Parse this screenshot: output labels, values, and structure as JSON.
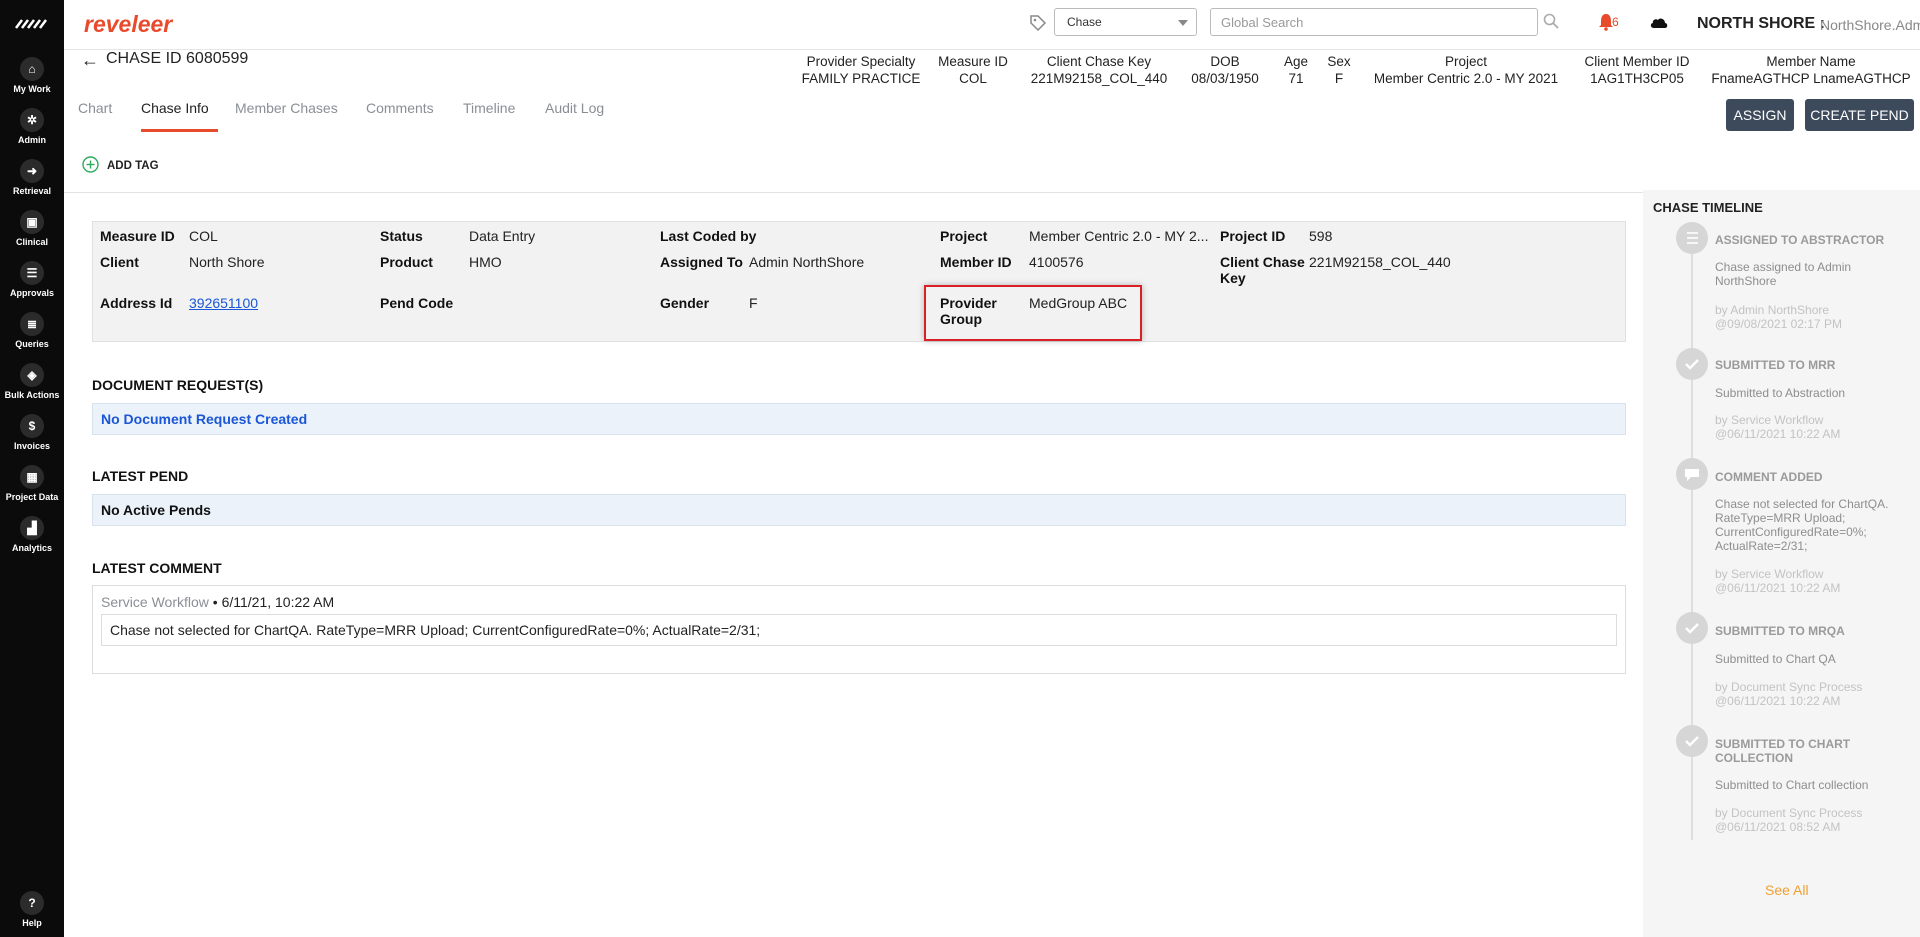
{
  "sidebar": {
    "items": [
      {
        "label": "My Work",
        "icon": "home-icon"
      },
      {
        "label": "Admin",
        "icon": "gear-icon"
      },
      {
        "label": "Retrieval",
        "icon": "arrow-in-icon"
      },
      {
        "label": "Clinical",
        "icon": "clipboard-icon"
      },
      {
        "label": "Approvals",
        "icon": "list-check-icon"
      },
      {
        "label": "Queries",
        "icon": "queries-icon"
      },
      {
        "label": "Bulk Actions",
        "icon": "layers-icon"
      },
      {
        "label": "Invoices",
        "icon": "dollar-icon"
      },
      {
        "label": "Project Data",
        "icon": "grid-icon"
      },
      {
        "label": "Analytics",
        "icon": "chart-icon"
      }
    ],
    "help_label": "Help"
  },
  "topbar": {
    "brand": "reveleer",
    "type_select": "Chase",
    "search_placeholder": "Global Search",
    "notification_count": "6",
    "org_name": "NORTH SHORE :",
    "user_name": "NorthShore.Admin"
  },
  "chase": {
    "title": "CHASE ID 6080599",
    "header_fields": [
      {
        "label": "Provider Specialty",
        "value": "FAMILY PRACTICE"
      },
      {
        "label": "Measure ID",
        "value": "COL"
      },
      {
        "label": "Client Chase Key",
        "value": "221M92158_COL_440"
      },
      {
        "label": "DOB",
        "value": "08/03/1950"
      },
      {
        "label": "Age",
        "value": "71"
      },
      {
        "label": "Sex",
        "value": "F"
      },
      {
        "label": "Project",
        "value": "Member Centric 2.0 - MY 2021"
      },
      {
        "label": "Client Member ID",
        "value": "1AG1TH3CP05"
      },
      {
        "label": "Member Name",
        "value": "FnameAGTHCP LnameAGTHCP"
      }
    ]
  },
  "tabs": [
    "Chart",
    "Chase Info",
    "Member Chases",
    "Comments",
    "Timeline",
    "Audit Log"
  ],
  "actions": {
    "assign": "ASSIGN",
    "create_pend": "CREATE PEND"
  },
  "add_tag": "ADD TAG",
  "info": {
    "measure_id": {
      "label": "Measure ID",
      "value": "COL"
    },
    "client": {
      "label": "Client",
      "value": "North Shore"
    },
    "address_id": {
      "label": "Address Id",
      "value": "392651100"
    },
    "status": {
      "label": "Status",
      "value": "Data Entry"
    },
    "product": {
      "label": "Product",
      "value": "HMO"
    },
    "pend_code": {
      "label": "Pend Code",
      "value": ""
    },
    "last_coded_by": {
      "label": "Last Coded by",
      "value": ""
    },
    "assigned_to": {
      "label": "Assigned To",
      "value": "Admin NorthShore"
    },
    "gender": {
      "label": "Gender",
      "value": "F"
    },
    "project": {
      "label": "Project",
      "value": "Member Centric 2.0 - MY 2..."
    },
    "member_id": {
      "label": "Member ID",
      "value": "4100576"
    },
    "provider_group": {
      "label_line1": "Provider",
      "label_line2": "Group",
      "value": "MedGroup ABC"
    },
    "project_id": {
      "label": "Project ID",
      "value": "598"
    },
    "client_chase_key": {
      "label_line1": "Client Chase",
      "label_line2": "Key",
      "value": "221M92158_COL_440"
    }
  },
  "document_requests": {
    "title": "DOCUMENT REQUEST(S)",
    "empty": "No Document Request Created"
  },
  "latest_pend": {
    "title": "LATEST PEND",
    "empty": "No Active Pends"
  },
  "latest_comment": {
    "title": "LATEST COMMENT",
    "author": "Service Workflow",
    "timestamp": " • 6/11/21, 10:22 AM",
    "text": "Chase not selected for ChartQA. RateType=MRR Upload; CurrentConfiguredRate=0%; ActualRate=2/31;"
  },
  "timeline": {
    "title": "CHASE TIMELINE",
    "events": [
      {
        "head": "ASSIGNED TO ABSTRACTOR",
        "desc": "Chase assigned to Admin NorthShore",
        "by": "by Admin NorthShore",
        "at": "@09/08/2021 02:17 PM",
        "icon": "list-icon"
      },
      {
        "head": "SUBMITTED TO MRR",
        "desc": "Submitted to Abstraction",
        "by": "by Service Workflow",
        "at": "@06/11/2021 10:22 AM",
        "icon": "check-icon"
      },
      {
        "head": "COMMENT ADDED",
        "desc": "Chase not selected for ChartQA. RateType=MRR Upload; CurrentConfiguredRate=0%; ActualRate=2/31;",
        "by": "by Service Workflow",
        "at": "@06/11/2021 10:22 AM",
        "icon": "comment-icon"
      },
      {
        "head": "SUBMITTED TO MRQA",
        "desc": "Submitted to Chart QA",
        "by": "by Document Sync Process",
        "at": "@06/11/2021 10:22 AM",
        "icon": "check-icon"
      },
      {
        "head": "SUBMITTED TO CHART COLLECTION",
        "desc": "Submitted to Chart collection",
        "by": "by Document Sync Process",
        "at": "@06/11/2021 08:52 AM",
        "icon": "check-icon"
      }
    ],
    "see_all": "See All"
  },
  "colors": {
    "accent": "#e84a2c",
    "sidebar": "#0b0b0b",
    "button": "#3d4a5c",
    "highlight_box": "#d92027",
    "link": "#1a56d6",
    "see_all": "#f0a030"
  }
}
